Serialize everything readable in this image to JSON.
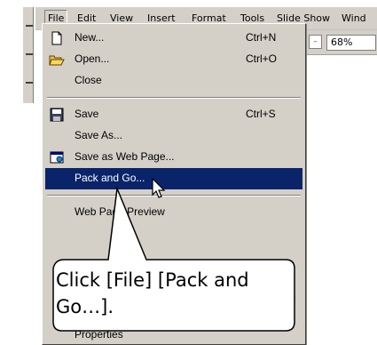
{
  "menubar": {
    "items": [
      "File",
      "Edit",
      "View",
      "Insert",
      "Format",
      "Tools",
      "Slide Show",
      "Wind"
    ]
  },
  "toolbar": {
    "zoom": "68%"
  },
  "file_menu": {
    "items": [
      {
        "label": "New...",
        "shortcut": "Ctrl+N",
        "icon": "new-document-icon"
      },
      {
        "label": "Open...",
        "shortcut": "Ctrl+O",
        "icon": "open-folder-icon"
      },
      {
        "label": "Close",
        "shortcut": "",
        "icon": ""
      },
      {
        "label": "Save",
        "shortcut": "Ctrl+S",
        "icon": "floppy-disk-icon"
      },
      {
        "label": "Save As...",
        "shortcut": "",
        "icon": ""
      },
      {
        "label": "Save as Web Page...",
        "shortcut": "",
        "icon": "web-page-icon"
      },
      {
        "label": "Pack and Go...",
        "shortcut": "",
        "icon": ""
      },
      {
        "label": "Web Page Preview",
        "shortcut": "",
        "icon": ""
      },
      {
        "label": "Properties",
        "shortcut": "",
        "icon": ""
      }
    ],
    "highlighted": "Pack and Go..."
  },
  "callout": {
    "text": "Click [File] [Pack and Go…]."
  },
  "colors": {
    "menu_face": "#d4d0c8",
    "highlight": "#0a246a",
    "highlight_text": "#ffffff"
  }
}
